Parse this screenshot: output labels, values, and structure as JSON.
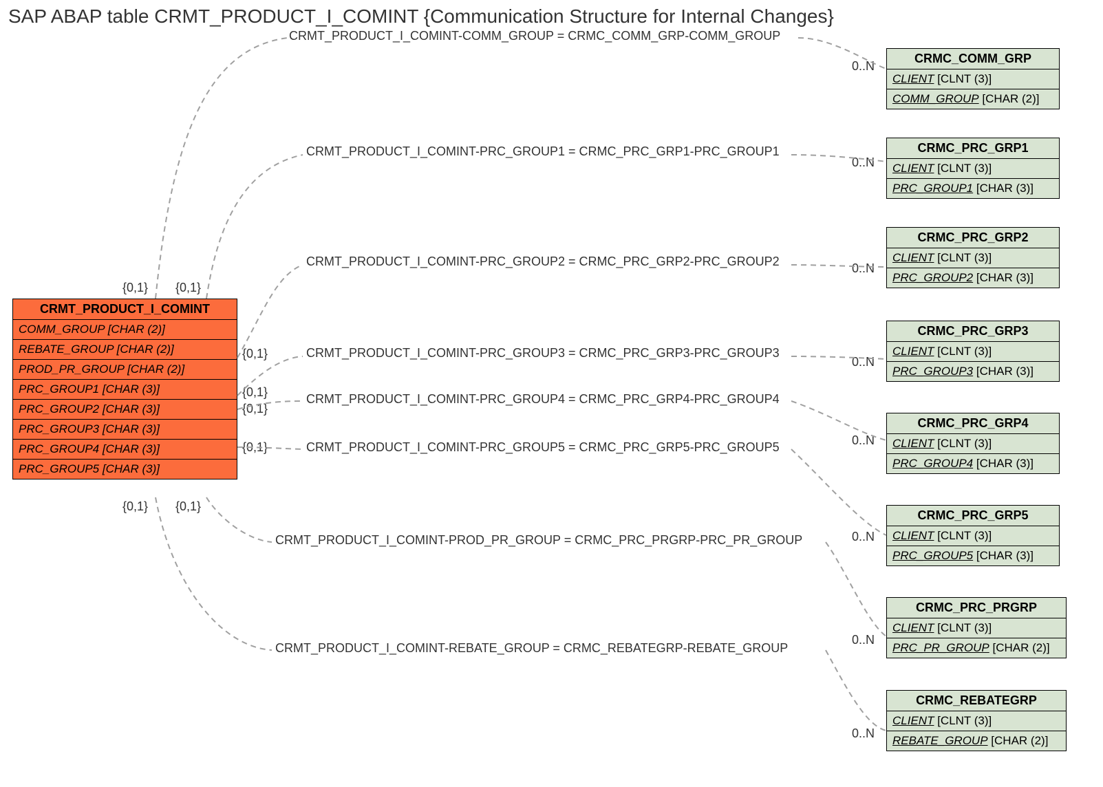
{
  "title": "SAP ABAP table CRMT_PRODUCT_I_COMINT {Communication Structure for Internal Changes}",
  "main_entity": {
    "name": "CRMT_PRODUCT_I_COMINT",
    "fields": [
      "COMM_GROUP [CHAR (2)]",
      "REBATE_GROUP [CHAR (2)]",
      "PROD_PR_GROUP [CHAR (2)]",
      "PRC_GROUP1 [CHAR (3)]",
      "PRC_GROUP2 [CHAR (3)]",
      "PRC_GROUP3 [CHAR (3)]",
      "PRC_GROUP4 [CHAR (3)]",
      "PRC_GROUP5 [CHAR (3)]"
    ]
  },
  "targets": [
    {
      "name": "CRMC_COMM_GRP",
      "fields": [
        {
          "fn": "CLIENT",
          "ft": "[CLNT (3)]"
        },
        {
          "fn": "COMM_GROUP",
          "ft": "[CHAR (2)]"
        }
      ]
    },
    {
      "name": "CRMC_PRC_GRP1",
      "fields": [
        {
          "fn": "CLIENT",
          "ft": "[CLNT (3)]"
        },
        {
          "fn": "PRC_GROUP1",
          "ft": "[CHAR (3)]"
        }
      ]
    },
    {
      "name": "CRMC_PRC_GRP2",
      "fields": [
        {
          "fn": "CLIENT",
          "ft": "[CLNT (3)]"
        },
        {
          "fn": "PRC_GROUP2",
          "ft": "[CHAR (3)]"
        }
      ]
    },
    {
      "name": "CRMC_PRC_GRP3",
      "fields": [
        {
          "fn": "CLIENT",
          "ft": "[CLNT (3)]"
        },
        {
          "fn": "PRC_GROUP3",
          "ft": "[CHAR (3)]"
        }
      ]
    },
    {
      "name": "CRMC_PRC_GRP4",
      "fields": [
        {
          "fn": "CLIENT",
          "ft": "[CLNT (3)]"
        },
        {
          "fn": "PRC_GROUP4",
          "ft": "[CHAR (3)]"
        }
      ]
    },
    {
      "name": "CRMC_PRC_GRP5",
      "fields": [
        {
          "fn": "CLIENT",
          "ft": "[CLNT (3)]"
        },
        {
          "fn": "PRC_GROUP5",
          "ft": "[CHAR (3)]"
        }
      ]
    },
    {
      "name": "CRMC_PRC_PRGRP",
      "fields": [
        {
          "fn": "CLIENT",
          "ft": "[CLNT (3)]"
        },
        {
          "fn": "PRC_PR_GROUP",
          "ft": "[CHAR (2)]"
        }
      ]
    },
    {
      "name": "CRMC_REBATEGRP",
      "fields": [
        {
          "fn": "CLIENT",
          "ft": "[CLNT (3)]"
        },
        {
          "fn": "REBATE_GROUP",
          "ft": "[CHAR (2)]"
        }
      ]
    }
  ],
  "relations": [
    {
      "text": "CRMT_PRODUCT_I_COMINT-COMM_GROUP = CRMC_COMM_GRP-COMM_GROUP",
      "card_left": "{0,1}",
      "card_right": "0..N"
    },
    {
      "text": "CRMT_PRODUCT_I_COMINT-PRC_GROUP1 = CRMC_PRC_GRP1-PRC_GROUP1",
      "card_left": "{0,1}",
      "card_right": "0..N"
    },
    {
      "text": "CRMT_PRODUCT_I_COMINT-PRC_GROUP2 = CRMC_PRC_GRP2-PRC_GROUP2",
      "card_left": "{0,1}",
      "card_right": "0..N"
    },
    {
      "text": "CRMT_PRODUCT_I_COMINT-PRC_GROUP3 = CRMC_PRC_GRP3-PRC_GROUP3",
      "card_left": "{0,1}",
      "card_right": "0..N"
    },
    {
      "text": "CRMT_PRODUCT_I_COMINT-PRC_GROUP4 = CRMC_PRC_GRP4-PRC_GROUP4",
      "card_left": "{0,1}",
      "card_right": "0..N"
    },
    {
      "text": "CRMT_PRODUCT_I_COMINT-PRC_GROUP5 = CRMC_PRC_GRP5-PRC_GROUP5",
      "card_left": "{0,1}",
      "card_right": "0..N"
    },
    {
      "text": "CRMT_PRODUCT_I_COMINT-PROD_PR_GROUP = CRMC_PRC_PRGRP-PRC_PR_GROUP",
      "card_left": "{0,1}",
      "card_right": "0..N"
    },
    {
      "text": "CRMT_PRODUCT_I_COMINT-REBATE_GROUP = CRMC_REBATEGRP-REBATE_GROUP",
      "card_left": "{0,1}",
      "card_right": "0..N"
    }
  ]
}
